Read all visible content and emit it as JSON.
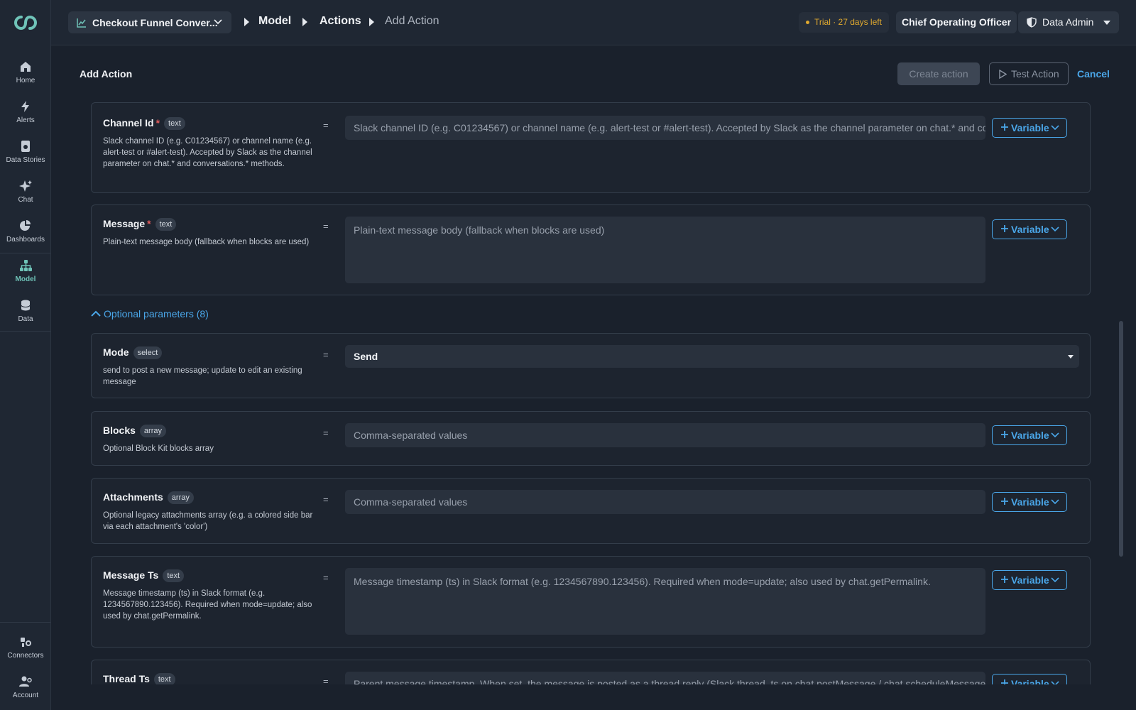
{
  "sidebar": {
    "items": [
      {
        "label": "Home",
        "icon": "home-icon"
      },
      {
        "label": "Alerts",
        "icon": "bolt-icon"
      },
      {
        "label": "Data Stories",
        "icon": "story-icon"
      },
      {
        "label": "Chat",
        "icon": "sparkle-icon"
      },
      {
        "label": "Dashboards",
        "icon": "pie-icon"
      },
      {
        "label": "Model",
        "icon": "model-icon",
        "active": true
      },
      {
        "label": "Data",
        "icon": "database-icon"
      }
    ],
    "bottom": [
      {
        "label": "Connectors",
        "icon": "plug-icon"
      },
      {
        "label": "Account",
        "icon": "user-gear-icon"
      }
    ]
  },
  "topbar": {
    "dataset": "Checkout Funnel Conver...",
    "crumbs": [
      "Model",
      "Actions",
      "Add Action"
    ],
    "trial": "Trial · 27 days left",
    "role": "Chief Operating Officer",
    "admin": "Data Admin"
  },
  "header": {
    "title": "Add Action",
    "create": "Create action",
    "test": "Test Action",
    "cancel": "Cancel"
  },
  "variable_label": "Variable",
  "eq": "=",
  "params": {
    "channel": {
      "name": "Channel Id",
      "type": "text",
      "desc": "Slack channel ID (e.g. C01234567) or channel name (e.g. alert-test or #alert-test). Accepted by Slack as the channel parameter on chat.* and conversations.* methods.",
      "placeholder": "Slack channel ID (e.g. C01234567) or channel name (e.g. alert-test or #alert-test). Accepted by Slack as the channel parameter on chat.* and conv"
    },
    "message": {
      "name": "Message",
      "type": "text",
      "desc": "Plain-text message body (fallback when blocks are used)",
      "placeholder": "Plain-text message body (fallback when blocks are used)"
    }
  },
  "optional_label": "Optional parameters (8)",
  "optional": {
    "mode": {
      "name": "Mode",
      "type": "select",
      "desc": "send to post a new message; update to edit an existing message",
      "value": "Send"
    },
    "blocks": {
      "name": "Blocks",
      "type": "array",
      "desc": "Optional Block Kit blocks array",
      "placeholder": "Comma-separated values"
    },
    "attachments": {
      "name": "Attachments",
      "type": "array",
      "desc": "Optional legacy attachments array (e.g. a colored side bar via each attachment's 'color')",
      "placeholder": "Comma-separated values"
    },
    "message_ts": {
      "name": "Message Ts",
      "type": "text",
      "desc": "Message timestamp (ts) in Slack format (e.g. 1234567890.123456). Required when mode=update; also used by chat.getPermalink.",
      "placeholder": "Message timestamp (ts) in Slack format (e.g. 1234567890.123456). Required when mode=update; also used by chat.getPermalink."
    },
    "thread_ts": {
      "name": "Thread Ts",
      "type": "text",
      "placeholder": "Parent message timestamp. When set, the message is posted as a thread reply (Slack thread_ts on chat.postMessage / chat.scheduleMessage)."
    }
  },
  "colors": {
    "accent": "#4aa6e8",
    "brand": "#6fc3b8",
    "trial": "#e0a92f",
    "required": "#e25b5b"
  }
}
